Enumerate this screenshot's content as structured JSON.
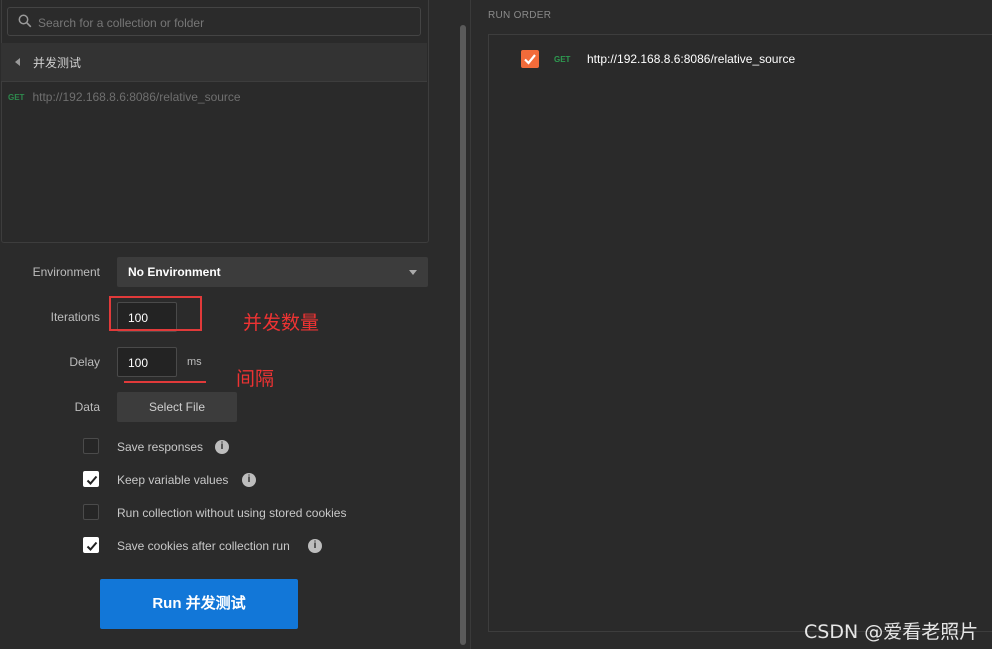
{
  "search": {
    "placeholder": "Search for a collection or folder"
  },
  "folder": {
    "name": "并发测试"
  },
  "request": {
    "method": "GET",
    "url": "http://192.168.8.6:8086/relative_source"
  },
  "form": {
    "environment_label": "Environment",
    "environment_value": "No Environment",
    "iterations_label": "Iterations",
    "iterations_value": "100",
    "delay_label": "Delay",
    "delay_value": "100",
    "delay_unit": "ms",
    "data_label": "Data",
    "select_file_label": "Select File"
  },
  "options": [
    {
      "label": "Save responses",
      "checked": false,
      "info": true
    },
    {
      "label": "Keep variable values",
      "checked": true,
      "info": true
    },
    {
      "label": "Run collection without using stored cookies",
      "checked": false,
      "info": false
    },
    {
      "label": "Save cookies after collection run",
      "checked": true,
      "info": true
    }
  ],
  "run_button": {
    "label": "Run 并发测试"
  },
  "annotations": {
    "concurrency": "并发数量",
    "interval": "间隔"
  },
  "run_order": {
    "title": "RUN ORDER",
    "items": [
      {
        "method": "GET",
        "url": "http://192.168.8.6:8086/relative_source",
        "checked": true
      }
    ]
  },
  "watermark": "CSDN @爱看老照片",
  "colors": {
    "accent_blue": "#1277d8",
    "checkbox_orange": "#f26b3a",
    "annotation_red": "#e13a3a",
    "get_green": "#2e9a50"
  }
}
